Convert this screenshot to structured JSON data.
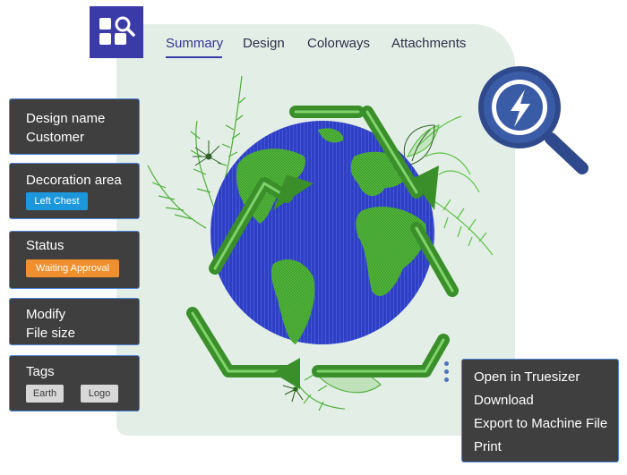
{
  "tabs": [
    {
      "label": "Summary",
      "active": true
    },
    {
      "label": "Design",
      "active": false
    },
    {
      "label": "Colorways",
      "active": false
    },
    {
      "label": "Attachments",
      "active": false
    }
  ],
  "info_cards": {
    "design": {
      "name_label": "Design name",
      "customer_label": "Customer"
    },
    "decoration": {
      "title": "Decoration area",
      "value": "Left Chest"
    },
    "status": {
      "title": "Status",
      "value": "Waiting Approval"
    },
    "modify": {
      "title": "Modify",
      "subtitle": "File size"
    },
    "tags": {
      "title": "Tags",
      "items": [
        "Earth",
        "Logo"
      ]
    }
  },
  "context_menu": {
    "items": [
      "Open in Truesizer",
      "Download",
      "Export to Machine File",
      "Print"
    ]
  },
  "icons": {
    "app_logo": "app-grid-search-icon",
    "badge": "lightning-search-icon",
    "more": "kebab-menu-icon"
  },
  "colors": {
    "brand": "#3a3aa8",
    "panel": "#e3efe6",
    "card_bg": "#3f3f3f",
    "card_border": "#4e86d8",
    "decoration_badge": "#1d97db",
    "status_badge": "#ef8f2d",
    "tag_badge": "#d7d7d7",
    "earth_blue": "#2e3fc4",
    "earth_green": "#3f9d2c"
  }
}
